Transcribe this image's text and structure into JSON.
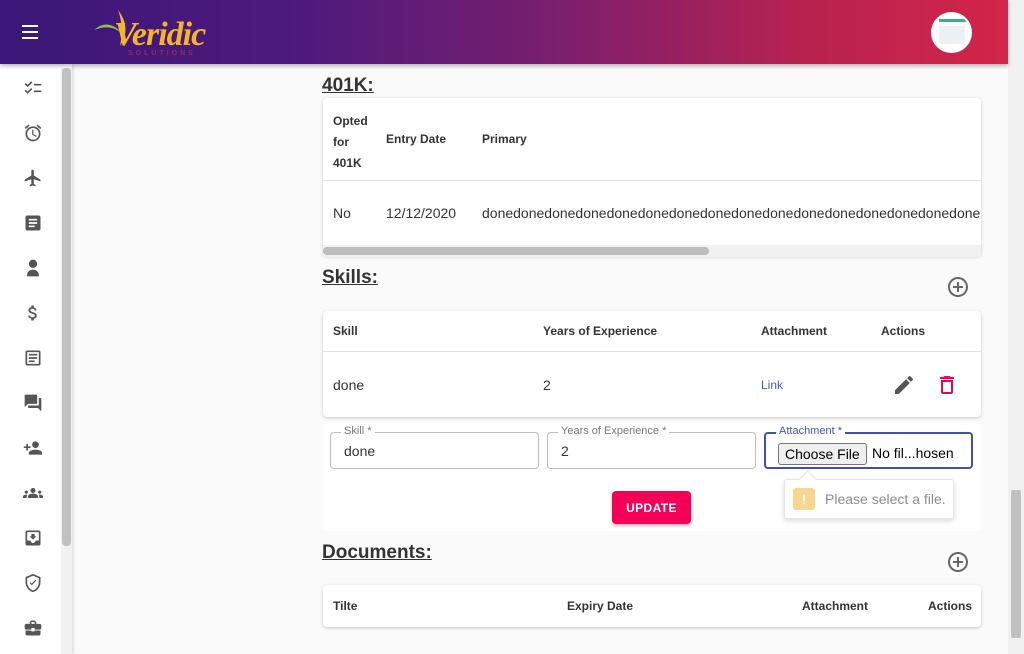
{
  "header": {
    "logo_text": "Veridic",
    "logo_sub": "SOLUTIONS"
  },
  "sidebar": {
    "items": [
      {
        "icon": "checklist-icon"
      },
      {
        "icon": "alarm-icon"
      },
      {
        "icon": "flight-icon"
      },
      {
        "icon": "list-alt-icon"
      },
      {
        "icon": "badge-icon"
      },
      {
        "icon": "dollar-icon"
      },
      {
        "icon": "document-icon"
      },
      {
        "icon": "chat-icon"
      },
      {
        "icon": "add-person-icon"
      },
      {
        "icon": "group-icon"
      },
      {
        "icon": "inbox-icon"
      },
      {
        "icon": "verified-icon"
      },
      {
        "icon": "briefcase-icon"
      }
    ]
  },
  "k401": {
    "title": "401K:",
    "headers": {
      "opted": "Opted for 401K",
      "opted_l1": "Opted",
      "opted_l2": "for",
      "opted_l3": "401K",
      "entry_date": "Entry Date",
      "primary": "Primary"
    },
    "row": {
      "opted": "No",
      "entry_date": "12/12/2020",
      "primary": "donedonedonedonedonedonedonedonedonedonedonedonedonedonedonedone"
    }
  },
  "skills": {
    "title": "Skills:",
    "headers": {
      "skill": "Skill",
      "years": "Years of Experience",
      "attachment": "Attachment",
      "actions": "Actions"
    },
    "row": {
      "skill": "done",
      "years": "2",
      "attachment": "Link"
    },
    "form": {
      "skill_label": "Skill *",
      "skill_value": "done",
      "years_label": "Years of Experience *",
      "years_value": "2",
      "attachment_label": "Attachment *",
      "choose_file": "Choose File",
      "file_status": "No fil...hosen",
      "update": "UPDATE",
      "tooltip": "Please select a file."
    }
  },
  "documents": {
    "title": "Documents:",
    "headers": {
      "title": "Tilte",
      "expiry": "Expiry Date",
      "attachment": "Attachment",
      "actions": "Actions"
    }
  }
}
